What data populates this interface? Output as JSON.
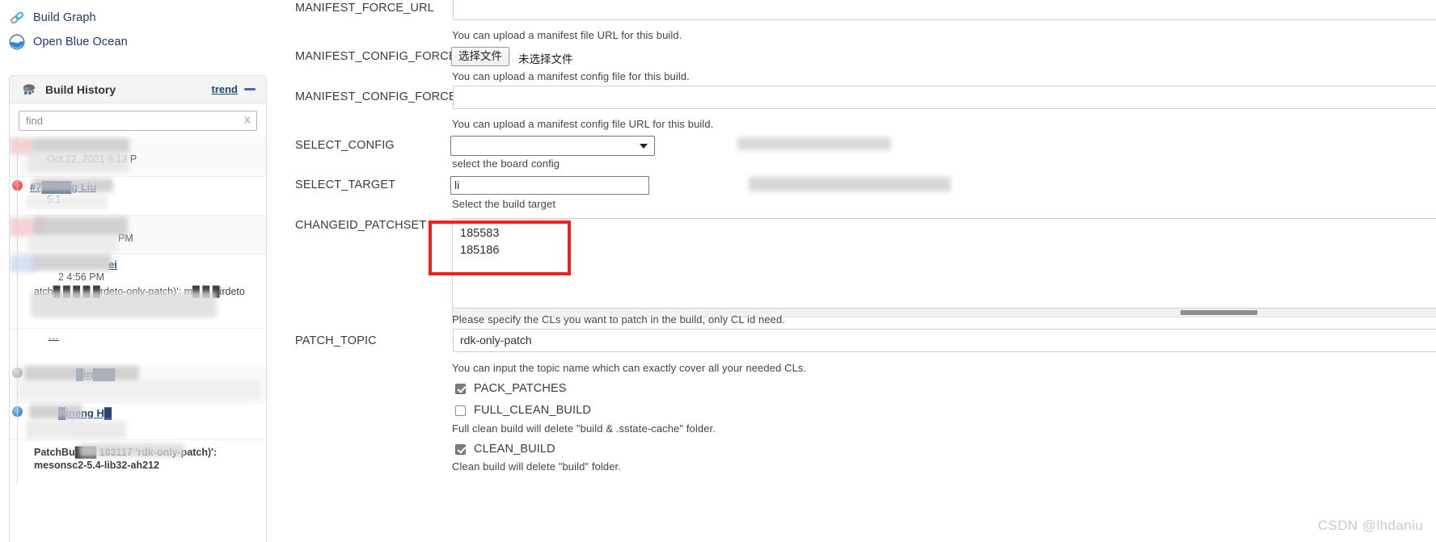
{
  "sidebar": {
    "tasks": [
      {
        "label": "Build Graph",
        "icon": "chain-link-icon"
      },
      {
        "label": "Open Blue Ocean",
        "icon": "blue-ocean-icon"
      }
    ],
    "build_history": {
      "title": "Build History",
      "icon": "build-history-icon",
      "trend_link": "trend",
      "collapse_icon": "minus-icon",
      "find": {
        "value": "",
        "placeholder": "find",
        "clear": "X"
      },
      "rows": [
        {
          "status": "grey",
          "link": "",
          "date": "Oct 22, 2021 6:13 P",
          "desc": ""
        },
        {
          "status": "red",
          "link": "#7████g Liu",
          "date": "5:1",
          "desc": ""
        },
        {
          "status": "red",
          "link": "",
          "date": "PM",
          "desc": ""
        },
        {
          "status": "grey",
          "link": "ei",
          "date": "2        4:56 PM",
          "desc": "atch█ █ █ █ █rdeto-only-patch)': m█ █ █irdeto"
        },
        {
          "status": "none",
          "link": "...",
          "date": "",
          "desc": ""
        },
        {
          "status": "grey",
          "link": "█in███",
          "date": "",
          "desc": ""
        },
        {
          "status": "blue",
          "link": "█ineng H█",
          "date": "",
          "desc": "PatchBu███ 183117 'rdk-only-patch)': mesonsc2-5.4-lib32-ah212"
        }
      ]
    }
  },
  "form": {
    "params": [
      {
        "name": "MANIFEST_FORCE_URL",
        "type": "text",
        "value": "",
        "desc": "You can upload a manifest file URL for this build."
      },
      {
        "name": "MANIFEST_CONFIG_FORCE",
        "type": "file",
        "button_label": "选择文件",
        "file_status": "未选择文件",
        "desc": "You can upload a manifest config file for this build."
      },
      {
        "name": "MANIFEST_CONFIG_FORCE_URL",
        "type": "text",
        "value": "",
        "desc": "You can upload a manifest config file URL for this build."
      },
      {
        "name": "SELECT_CONFIG",
        "type": "select",
        "value": "",
        "desc": "select the board config"
      },
      {
        "name": "SELECT_TARGET",
        "type": "target",
        "value": "li",
        "desc": "Select the build target"
      },
      {
        "name": "CHANGEID_PATCHSET",
        "type": "textarea",
        "lines": [
          "185583",
          "185186"
        ],
        "desc": "Please specify the CLs you want to patch in the build, only CL id need."
      },
      {
        "name": "PATCH_TOPIC",
        "type": "text",
        "value": "rdk-only-patch",
        "desc": "You can input the topic name which can exactly cover all your needed CLs."
      }
    ],
    "checkboxes": [
      {
        "label": "PACK_PATCHES",
        "checked": true,
        "desc": ""
      },
      {
        "label": "FULL_CLEAN_BUILD",
        "checked": false,
        "desc": "Full clean build will delete \"build & .sstate-cache\" folder."
      },
      {
        "label": "CLEAN_BUILD",
        "checked": true,
        "desc": "Clean build will delete \"build\" folder."
      }
    ],
    "annotation": {
      "type": "red-rectangle",
      "color": "#ee2020"
    }
  },
  "watermark": "CSDN @lhdaniu"
}
